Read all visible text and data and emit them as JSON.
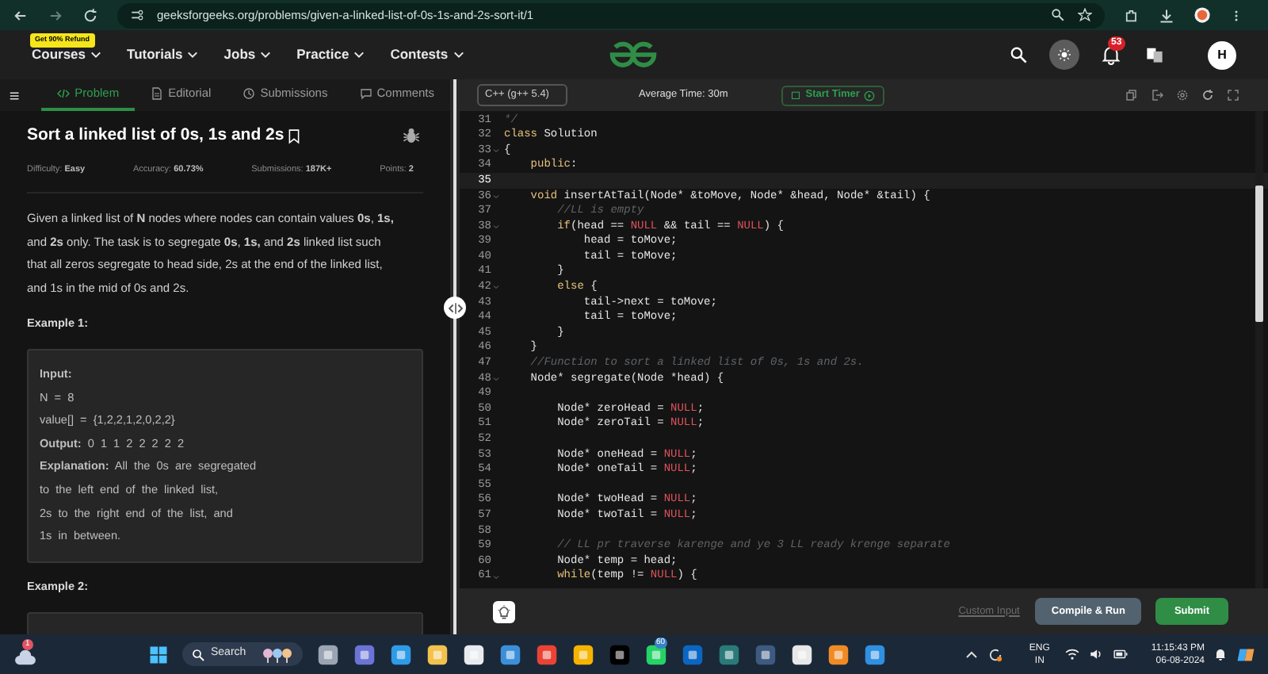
{
  "browser": {
    "url": "geeksforgeeks.org/problems/given-a-linked-list-of-0s-1s-and-2s-sort-it/1"
  },
  "site_nav": {
    "promo_badge": "Get 90% Refund",
    "menu": [
      "Courses",
      "Tutorials",
      "Jobs",
      "Practice",
      "Contests"
    ],
    "notification_count": "53",
    "avatar": "H"
  },
  "problem_tabs": [
    {
      "label": "Problem",
      "selected": true
    },
    {
      "label": "Editorial",
      "selected": false
    },
    {
      "label": "Submissions",
      "selected": false
    },
    {
      "label": "Comments",
      "selected": false
    }
  ],
  "problem": {
    "title": "Sort a linked list of 0s, 1s and 2s",
    "meta": [
      {
        "label": "Difficulty:",
        "value": "Easy"
      },
      {
        "label": "Accuracy:",
        "value": "60.73%"
      },
      {
        "label": "Submissions:",
        "value": "187K+"
      },
      {
        "label": "Points:",
        "value": "2"
      }
    ],
    "description": "Given a linked list of **N** nodes where nodes can contain values **0s**, **1s,** and **2s** only. The task is to segregate **0s**, **1s,** and **2s** linked list such that all zeros segregate to head side, 2s at the end of the linked list, and 1s in the mid of 0s and 2s.",
    "examples": [
      {
        "heading": "Example 1:",
        "lines": [
          "**Input:**",
          "N = 8",
          "value[] = {1,2,2,1,2,0,2,2}",
          "**Output:** 0 1 1 2 2 2 2 2",
          "**Explanation:** All the 0s are segregated",
          "to the left end of the linked list,",
          "2s to the right end of the list, and",
          "1s in between."
        ]
      },
      {
        "heading": "Example 2:"
      }
    ]
  },
  "editor": {
    "language": "C++ (g++ 5.4)",
    "average_time": "Average Time: 30m",
    "start_timer": "Start Timer",
    "lines": [
      {
        "n": "31",
        "fold": false,
        "current": false,
        "tokens": [
          {
            "t": "*/",
            "kind": "comment"
          }
        ]
      },
      {
        "n": "32",
        "fold": false,
        "current": false,
        "tokens": [
          {
            "t": "class",
            "kind": "keyword"
          },
          {
            "t": " Solution",
            "kind": "plain"
          }
        ]
      },
      {
        "n": "33",
        "fold": true,
        "current": false,
        "tokens": [
          {
            "t": "{",
            "kind": "plain"
          }
        ]
      },
      {
        "n": "34",
        "fold": false,
        "current": false,
        "tokens": [
          {
            "t": "    public",
            "kind": "keyword"
          },
          {
            "t": ":",
            "kind": "plain"
          }
        ]
      },
      {
        "n": "35",
        "fold": false,
        "current": true
      },
      {
        "n": "36",
        "fold": true,
        "current": false,
        "tokens": [
          {
            "t": "    void",
            "kind": "keyword"
          },
          {
            "t": " insertAtTail(Node* &toMove, Node* &head, Node* &tail) {",
            "kind": "plain"
          }
        ]
      },
      {
        "n": "37",
        "fold": false,
        "current": false,
        "tokens": [
          {
            "t": "        //LL is empty",
            "kind": "comment"
          }
        ]
      },
      {
        "n": "38",
        "fold": true,
        "current": false,
        "tokens": [
          {
            "t": "        if",
            "kind": "keyword"
          },
          {
            "t": "(head == ",
            "kind": "plain"
          },
          {
            "t": "NULL",
            "kind": "null"
          },
          {
            "t": " && tail == ",
            "kind": "plain"
          },
          {
            "t": "NULL",
            "kind": "null"
          },
          {
            "t": ") {",
            "kind": "plain"
          }
        ]
      },
      {
        "n": "39",
        "fold": false,
        "current": false,
        "tokens": [
          {
            "t": "            head = toMove;",
            "kind": "plain"
          }
        ]
      },
      {
        "n": "40",
        "fold": false,
        "current": false,
        "tokens": [
          {
            "t": "            tail = toMove;",
            "kind": "plain"
          }
        ]
      },
      {
        "n": "41",
        "fold": false,
        "current": false,
        "tokens": [
          {
            "t": "        }",
            "kind": "plain"
          }
        ]
      },
      {
        "n": "42",
        "fold": true,
        "current": false,
        "tokens": [
          {
            "t": "        else",
            "kind": "keyword"
          },
          {
            "t": " {",
            "kind": "plain"
          }
        ]
      },
      {
        "n": "43",
        "fold": false,
        "current": false,
        "tokens": [
          {
            "t": "            tail->next = toMove;",
            "kind": "plain"
          }
        ]
      },
      {
        "n": "44",
        "fold": false,
        "current": false,
        "tokens": [
          {
            "t": "            tail = toMove;",
            "kind": "plain"
          }
        ]
      },
      {
        "n": "45",
        "fold": false,
        "current": false,
        "tokens": [
          {
            "t": "        }",
            "kind": "plain"
          }
        ]
      },
      {
        "n": "46",
        "fold": false,
        "current": false,
        "tokens": [
          {
            "t": "    }",
            "kind": "plain"
          }
        ]
      },
      {
        "n": "47",
        "fold": false,
        "current": false,
        "tokens": [
          {
            "t": "    //Function to sort a linked list of 0s, 1s and 2s.",
            "kind": "comment"
          }
        ]
      },
      {
        "n": "48",
        "fold": true,
        "current": false,
        "tokens": [
          {
            "t": "    Node* segregate(Node *head) {",
            "kind": "plain"
          }
        ]
      },
      {
        "n": "49",
        "fold": false,
        "current": false
      },
      {
        "n": "50",
        "fold": false,
        "current": false,
        "tokens": [
          {
            "t": "        Node* zeroHead = ",
            "kind": "plain"
          },
          {
            "t": "NULL",
            "kind": "null"
          },
          {
            "t": ";",
            "kind": "plain"
          }
        ]
      },
      {
        "n": "51",
        "fold": false,
        "current": false,
        "tokens": [
          {
            "t": "        Node* zeroTail = ",
            "kind": "plain"
          },
          {
            "t": "NULL",
            "kind": "null"
          },
          {
            "t": ";",
            "kind": "plain"
          }
        ]
      },
      {
        "n": "52",
        "fold": false,
        "current": false
      },
      {
        "n": "53",
        "fold": false,
        "current": false,
        "tokens": [
          {
            "t": "        Node* oneHead = ",
            "kind": "plain"
          },
          {
            "t": "NULL",
            "kind": "null"
          },
          {
            "t": ";",
            "kind": "plain"
          }
        ]
      },
      {
        "n": "54",
        "fold": false,
        "current": false,
        "tokens": [
          {
            "t": "        Node* oneTail = ",
            "kind": "plain"
          },
          {
            "t": "NULL",
            "kind": "null"
          },
          {
            "t": ";",
            "kind": "plain"
          }
        ]
      },
      {
        "n": "55",
        "fold": false,
        "current": false
      },
      {
        "n": "56",
        "fold": false,
        "current": false,
        "tokens": [
          {
            "t": "        Node* twoHead = ",
            "kind": "plain"
          },
          {
            "t": "NULL",
            "kind": "null"
          },
          {
            "t": ";",
            "kind": "plain"
          }
        ]
      },
      {
        "n": "57",
        "fold": false,
        "current": false,
        "tokens": [
          {
            "t": "        Node* twoTail = ",
            "kind": "plain"
          },
          {
            "t": "NULL",
            "kind": "null"
          },
          {
            "t": ";",
            "kind": "plain"
          }
        ]
      },
      {
        "n": "58",
        "fold": false,
        "current": false
      },
      {
        "n": "59",
        "fold": false,
        "current": false,
        "tokens": [
          {
            "t": "        // LL pr traverse karenge and ye 3 LL ready krenge separate",
            "kind": "comment"
          }
        ]
      },
      {
        "n": "60",
        "fold": false,
        "current": false,
        "tokens": [
          {
            "t": "        Node* temp = head;",
            "kind": "plain"
          }
        ]
      },
      {
        "n": "61",
        "fold": true,
        "current": false,
        "tokens": [
          {
            "t": "        while",
            "kind": "keyword"
          },
          {
            "t": "(temp != ",
            "kind": "plain"
          },
          {
            "t": "NULL",
            "kind": "null"
          },
          {
            "t": ") {",
            "kind": "plain"
          }
        ]
      }
    ],
    "custom_input": "Custom Input",
    "compile_run": "Compile & Run",
    "submit": "Submit"
  },
  "taskbar": {
    "weather_badge": "1",
    "search": "Search",
    "whatsapp_badge": "60",
    "language": "ENG",
    "region": "IN",
    "time": "11:15:43 PM",
    "date": "06-08-2024"
  }
}
